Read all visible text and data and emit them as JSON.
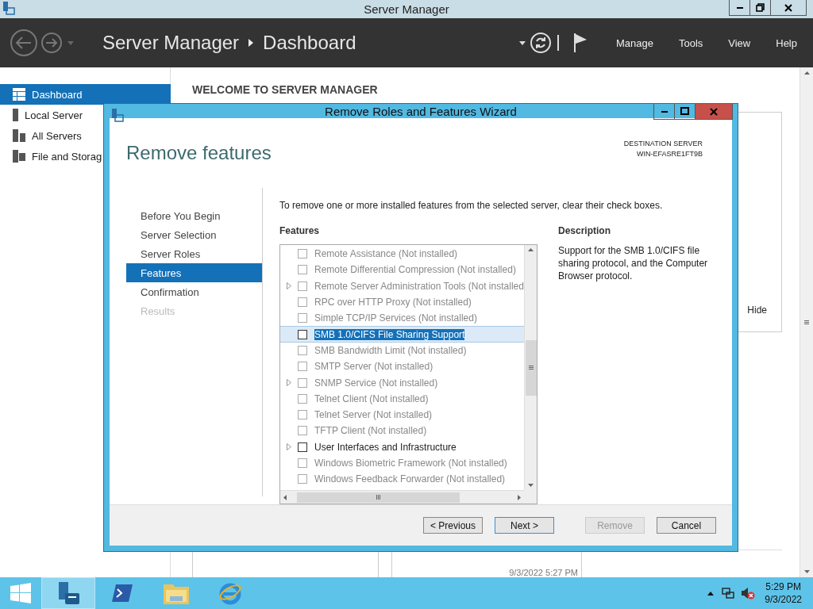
{
  "window": {
    "title": "Server Manager"
  },
  "header": {
    "breadcrumb": [
      "Server Manager",
      "Dashboard"
    ],
    "menu": [
      "Manage",
      "Tools",
      "View",
      "Help"
    ]
  },
  "sidebar": {
    "items": [
      {
        "label": "Dashboard",
        "kind": "dashboard",
        "selected": true
      },
      {
        "label": "Local Server",
        "kind": "local",
        "selected": false
      },
      {
        "label": "All Servers",
        "kind": "all",
        "selected": false
      },
      {
        "label": "File and Storag",
        "kind": "storage",
        "selected": false
      }
    ]
  },
  "welcome": {
    "title": "WELCOME TO SERVER MANAGER",
    "hide": "Hide",
    "timestamp": "9/3/2022 5:27 PM"
  },
  "wizard": {
    "title": "Remove Roles and Features Wizard",
    "heading": "Remove features",
    "destination_label": "DESTINATION SERVER",
    "destination": "WIN-EFASRE1FT9B",
    "steps": [
      {
        "label": "Before You Begin",
        "selected": false,
        "disabled": false
      },
      {
        "label": "Server Selection",
        "selected": false,
        "disabled": false
      },
      {
        "label": "Server Roles",
        "selected": false,
        "disabled": false
      },
      {
        "label": "Features",
        "selected": true,
        "disabled": false
      },
      {
        "label": "Confirmation",
        "selected": false,
        "disabled": false
      },
      {
        "label": "Results",
        "selected": false,
        "disabled": true
      }
    ],
    "instruction": "To remove one or more installed features from the selected server, clear their check boxes.",
    "features_label": "Features",
    "features": [
      {
        "label": "Remote Assistance (Not installed)",
        "installed": false,
        "expandable": false,
        "checked": false,
        "selected": false
      },
      {
        "label": "Remote Differential Compression (Not installed)",
        "installed": false,
        "expandable": false,
        "checked": false,
        "selected": false
      },
      {
        "label": "Remote Server Administration Tools (Not installed",
        "installed": false,
        "expandable": true,
        "checked": false,
        "selected": false
      },
      {
        "label": "RPC over HTTP Proxy (Not installed)",
        "installed": false,
        "expandable": false,
        "checked": false,
        "selected": false
      },
      {
        "label": "Simple TCP/IP Services (Not installed)",
        "installed": false,
        "expandable": false,
        "checked": false,
        "selected": false
      },
      {
        "label": "SMB 1.0/CIFS File Sharing Support",
        "installed": true,
        "expandable": false,
        "checked": false,
        "selected": true
      },
      {
        "label": "SMB Bandwidth Limit (Not installed)",
        "installed": false,
        "expandable": false,
        "checked": false,
        "selected": false
      },
      {
        "label": "SMTP Server (Not installed)",
        "installed": false,
        "expandable": false,
        "checked": false,
        "selected": false
      },
      {
        "label": "SNMP Service (Not installed)",
        "installed": false,
        "expandable": true,
        "checked": false,
        "selected": false
      },
      {
        "label": "Telnet Client (Not installed)",
        "installed": false,
        "expandable": false,
        "checked": false,
        "selected": false
      },
      {
        "label": "Telnet Server (Not installed)",
        "installed": false,
        "expandable": false,
        "checked": false,
        "selected": false
      },
      {
        "label": "TFTP Client (Not installed)",
        "installed": false,
        "expandable": false,
        "checked": false,
        "selected": false
      },
      {
        "label": "User Interfaces and Infrastructure",
        "installed": true,
        "expandable": true,
        "checked": false,
        "selected": false
      },
      {
        "label": "Windows Biometric Framework (Not installed)",
        "installed": false,
        "expandable": false,
        "checked": false,
        "selected": false
      },
      {
        "label": "Windows Feedback Forwarder (Not installed)",
        "installed": false,
        "expandable": false,
        "checked": false,
        "selected": false
      }
    ],
    "description_label": "Description",
    "description": "Support for the SMB 1.0/CIFS file sharing protocol, and the Computer Browser protocol.",
    "buttons": [
      {
        "label": "< Previous",
        "disabled": false,
        "default": false
      },
      {
        "label": "Next >",
        "disabled": false,
        "default": true
      },
      {
        "label": "Remove",
        "disabled": true,
        "default": false
      },
      {
        "label": "Cancel",
        "disabled": false,
        "default": false
      }
    ]
  },
  "taskbar": {
    "apps": [
      {
        "kind": "server-manager",
        "selected": true
      },
      {
        "kind": "powershell",
        "selected": false
      },
      {
        "kind": "explorer",
        "selected": false
      },
      {
        "kind": "browser",
        "selected": false
      }
    ],
    "clock": {
      "time": "5:29 PM",
      "date": "9/3/2022"
    }
  }
}
